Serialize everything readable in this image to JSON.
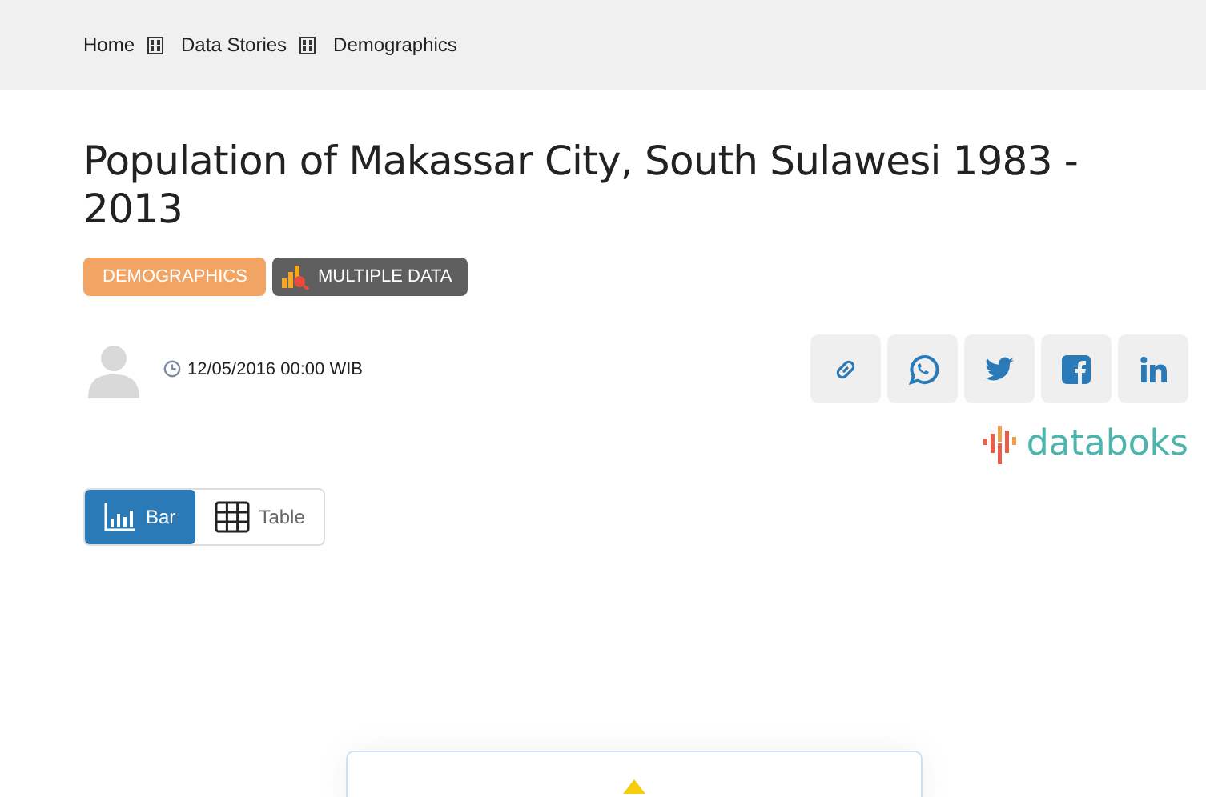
{
  "breadcrumb": [
    "Home",
    "Data Stories",
    "Demographics"
  ],
  "title": "Population of Makassar City, South Sulawesi 1983 - 2013",
  "tags": [
    {
      "label": "DEMOGRAPHICS",
      "kind": "category"
    },
    {
      "label": "MULTIPLE DATA",
      "kind": "multiple"
    }
  ],
  "date": "12/05/2016 00:00 WIB",
  "share": [
    {
      "kind": "link"
    },
    {
      "kind": "whatsapp"
    },
    {
      "kind": "twitter"
    },
    {
      "kind": "facebook"
    },
    {
      "kind": "linkedin"
    }
  ],
  "logo": "databoks",
  "views": [
    {
      "label": "Bar",
      "kind": "bar",
      "selected": true
    },
    {
      "label": "Table",
      "kind": "table",
      "selected": false
    }
  ]
}
